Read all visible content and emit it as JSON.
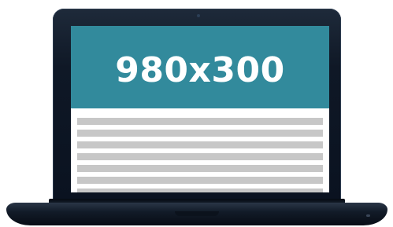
{
  "screen": {
    "banner": {
      "text": "980x300",
      "background_color": "#328a9c",
      "text_color": "#ffffff"
    },
    "content_lines": {
      "count": 7,
      "color": "#c7c7c7"
    }
  },
  "device": {
    "type": "laptop",
    "frame_color": "#0f1826"
  }
}
